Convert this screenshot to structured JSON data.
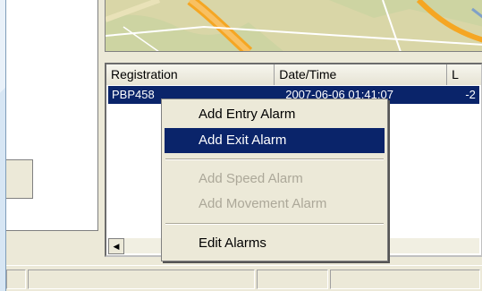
{
  "list": {
    "columns": [
      "Registration",
      "Date/Time",
      "L"
    ],
    "rows": [
      {
        "registration": "PBP458",
        "datetime": "2007-06-06 01:41:07",
        "extra": "-2"
      }
    ]
  },
  "context_menu": {
    "items": [
      {
        "label": "Add Entry Alarm",
        "state": "normal"
      },
      {
        "label": "Add Exit Alarm",
        "state": "selected"
      },
      {
        "label": "Add Speed Alarm",
        "state": "disabled"
      },
      {
        "label": "Add Movement Alarm",
        "state": "disabled"
      },
      {
        "label": "Edit Alarms",
        "state": "normal"
      }
    ]
  },
  "scrollbar": {
    "left_arrow_icon": "arrow-left-icon"
  },
  "colors": {
    "selection": "#0a246a",
    "window": "#ece9d8",
    "disabled_text": "#aca899",
    "map_road": "#f5a623",
    "map_land": "#d9d6a7"
  }
}
